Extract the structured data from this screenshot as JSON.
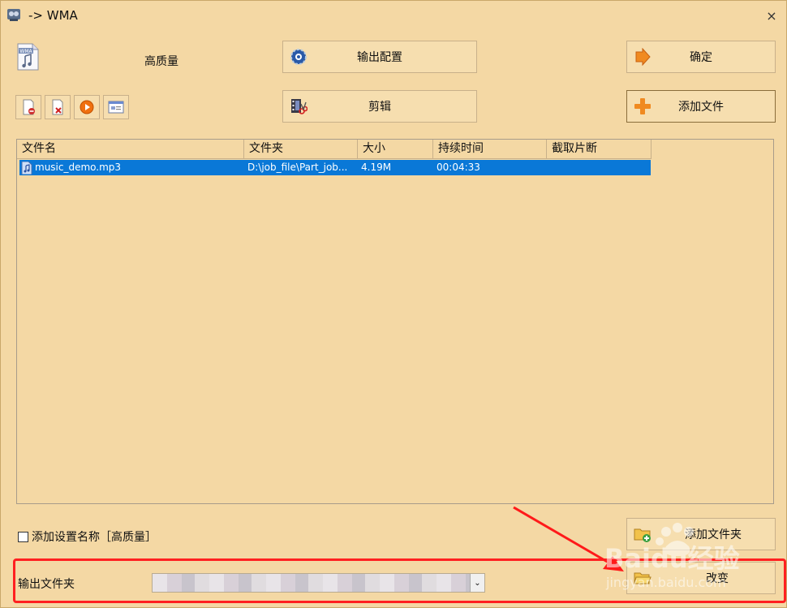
{
  "window": {
    "title": "-> WMA",
    "close_label": "×"
  },
  "format": {
    "icon_label": "WMA",
    "quality": "高质量"
  },
  "buttons": {
    "output_config": "输出配置",
    "edit": "剪辑",
    "ok": "确定",
    "add_file": "添加文件",
    "add_folder": "添加文件夹",
    "change": "改变"
  },
  "toolbar": {
    "tools": [
      "remove-file-icon",
      "clear-list-icon",
      "play-icon",
      "media-info-icon"
    ]
  },
  "file_table": {
    "columns": [
      "文件名",
      "文件夹",
      "大小",
      "持续时间",
      "截取片断"
    ],
    "rows": [
      {
        "name": "music_demo.mp3",
        "folder": "D:\\job_file\\Part_job...",
        "size": "4.19M",
        "duration": "00:04:33",
        "clip": ""
      }
    ]
  },
  "options": {
    "add_setting_name_label": "添加设置名称［高质量］",
    "add_setting_name_checked": false
  },
  "output": {
    "label": "输出文件夹",
    "value": ""
  },
  "watermark": {
    "brand": "Baidu经验",
    "url": "jingyan.baidu.com"
  },
  "colors": {
    "background": "#f4d8a4",
    "selection": "#0a78d7",
    "annotation": "#ff2020"
  }
}
